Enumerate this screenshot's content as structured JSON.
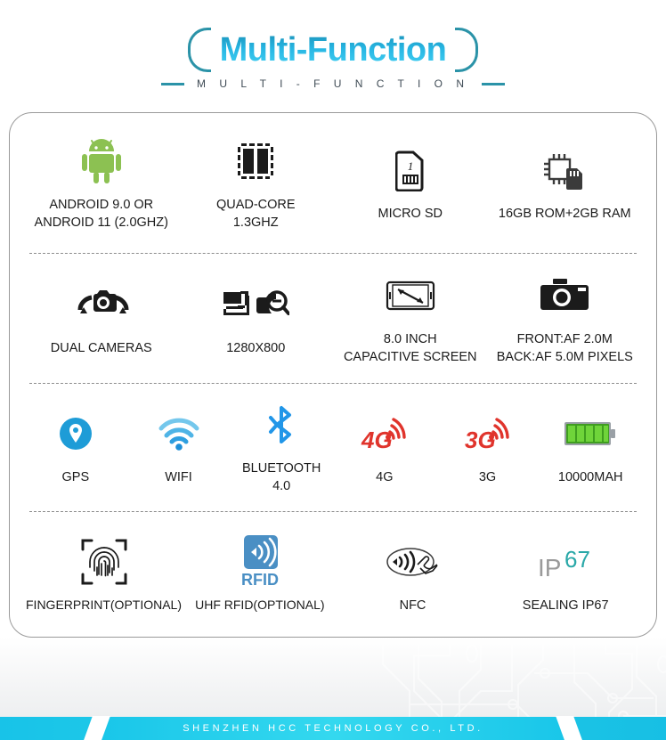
{
  "header": {
    "title": "Multi-Function",
    "subtitle": "M U L T I - F U N C T I O N"
  },
  "colors": {
    "title_gradient_start": "#1a8fb5",
    "title_gradient_end": "#46d3f5",
    "bracket": "#2b93a8",
    "subtitle_text": "#3f4b55",
    "android_green": "#8cc152",
    "icon_black": "#1b1b1b",
    "gps_blue": "#1e9cd7",
    "wifi_blue": "#3aa9e0",
    "bluetooth_blue": "#2196e8",
    "signal_red": "#e0342c",
    "battery_green": "#57c72b",
    "rfid_blue": "#4a8fc4",
    "ip67_teal": "#2aa8a8",
    "ip67_gray": "#9a9a9a",
    "footer_cyan": "#19c6e9"
  },
  "features": {
    "row1": [
      {
        "icon": "android-robot-icon",
        "label": "ANDROID 9.0 OR\nANDROID 11 (2.0GHZ)"
      },
      {
        "icon": "quad-core-chip-icon",
        "label": "QUAD-CORE\n1.3GHZ"
      },
      {
        "icon": "micro-sd-card-icon",
        "label": "MICRO SD"
      },
      {
        "icon": "memory-chip-icon",
        "label": "16GB ROM+2GB RAM"
      }
    ],
    "row2": [
      {
        "icon": "dual-camera-rotate-icon",
        "label": "DUAL CAMERAS"
      },
      {
        "icon": "resolution-zoom-icon",
        "label": "1280X800"
      },
      {
        "icon": "screen-diagonal-icon",
        "label": "8.0 INCH\nCAPACITIVE SCREEN"
      },
      {
        "icon": "camera-icon",
        "label": "FRONT:AF 2.0M\nBACK:AF 5.0M PIXELS"
      }
    ],
    "row3": [
      {
        "icon": "gps-pin-icon",
        "label": "GPS"
      },
      {
        "icon": "wifi-icon",
        "label": "WIFI"
      },
      {
        "icon": "bluetooth-icon",
        "label": "BLUETOOTH 4.0"
      },
      {
        "icon": "4g-signal-icon",
        "label": "4G"
      },
      {
        "icon": "3g-signal-icon",
        "label": "3G"
      },
      {
        "icon": "battery-icon",
        "label": "10000MAH"
      }
    ],
    "row4": [
      {
        "icon": "fingerprint-icon",
        "label": "FINGERPRINT(OPTIONAL)"
      },
      {
        "icon": "rfid-icon",
        "label": "UHF RFID(OPTIONAL)"
      },
      {
        "icon": "nfc-icon",
        "label": "NFC"
      },
      {
        "icon": "ip67-icon",
        "label": "SEALING IP67"
      }
    ]
  },
  "icon_text": {
    "sd_number": "1",
    "rfid_label": "RFID",
    "signal_4g": "4G",
    "signal_3g": "3G",
    "ip_prefix": "IP",
    "ip_rating": "67"
  },
  "footer": {
    "company": "SHENZHEN HCC TECHNOLOGY CO., LTD."
  }
}
